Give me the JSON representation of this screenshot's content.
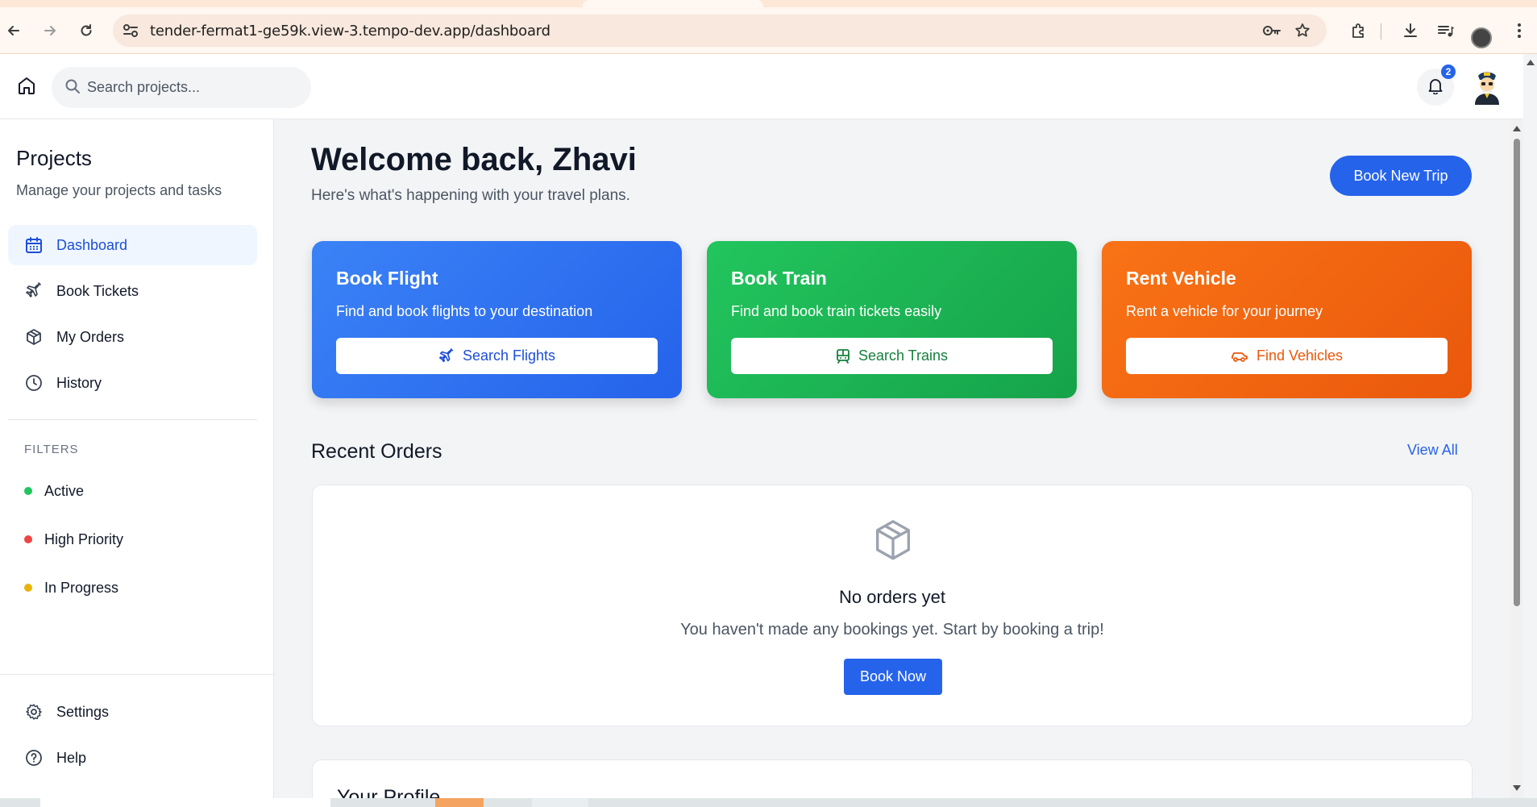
{
  "browser": {
    "url": "tender-fermat1-ge59k.view-3.tempo-dev.app/dashboard"
  },
  "header": {
    "search_placeholder": "Search projects...",
    "notification_count": "2"
  },
  "sidebar": {
    "title": "Projects",
    "subtitle": "Manage your projects and tasks",
    "items": [
      {
        "label": "Dashboard",
        "icon": "calendar-icon"
      },
      {
        "label": "Book Tickets",
        "icon": "plane-icon"
      },
      {
        "label": "My Orders",
        "icon": "package-icon"
      },
      {
        "label": "History",
        "icon": "clock-icon"
      }
    ],
    "filters_heading": "FILTERS",
    "filters": [
      {
        "label": "Active",
        "color": "#22c55e"
      },
      {
        "label": "High Priority",
        "color": "#ef4444"
      },
      {
        "label": "In Progress",
        "color": "#eab308"
      }
    ],
    "bottom": [
      {
        "label": "Settings",
        "icon": "gear-icon"
      },
      {
        "label": "Help",
        "icon": "help-circle-icon"
      }
    ]
  },
  "main": {
    "welcome": "Welcome back, Zhavi",
    "welcome_sub": "Here's what's happening with your travel plans.",
    "book_new_trip": "Book New Trip",
    "cards": [
      {
        "title": "Book Flight",
        "desc": "Find and book flights to your destination",
        "button": "Search Flights",
        "color": "#2563eb"
      },
      {
        "title": "Book Train",
        "desc": "Find and book train tickets easily",
        "button": "Search Trains",
        "color": "#16a34a"
      },
      {
        "title": "Rent Vehicle",
        "desc": "Rent a vehicle for your journey",
        "button": "Find Vehicles",
        "color": "#ea580c"
      }
    ],
    "recent_orders": {
      "title": "Recent Orders",
      "view_all": "View All",
      "empty_title": "No orders yet",
      "empty_sub": "You haven't made any bookings yet. Start by booking a trip!",
      "book_now": "Book Now"
    },
    "profile_title": "Your Profile"
  }
}
